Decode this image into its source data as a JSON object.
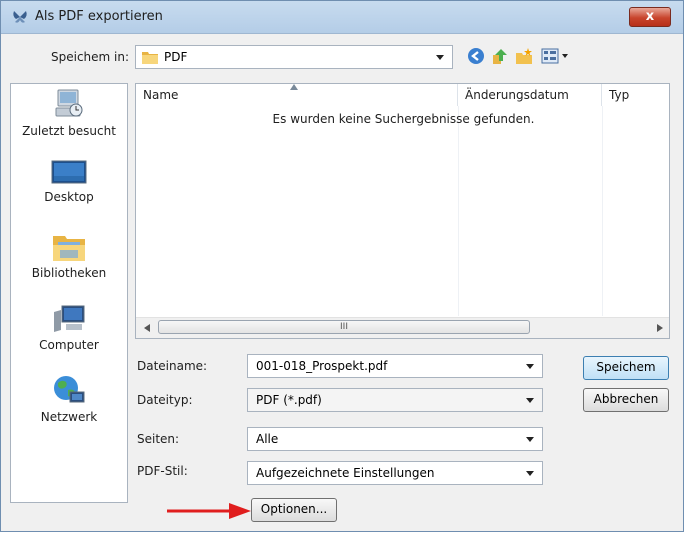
{
  "window": {
    "title": "Als PDF exportieren",
    "close_label": "x"
  },
  "location": {
    "label": "Speichem in:",
    "value": "PDF"
  },
  "sidebar": {
    "items": [
      {
        "label": "Zuletzt besucht",
        "icon": "recent-places-icon"
      },
      {
        "label": "Desktop",
        "icon": "desktop-icon"
      },
      {
        "label": "Bibliotheken",
        "icon": "libraries-icon"
      },
      {
        "label": "Computer",
        "icon": "computer-icon"
      },
      {
        "label": "Netzwerk",
        "icon": "network-icon"
      }
    ]
  },
  "filelist": {
    "columns": [
      "Name",
      "Änderungsdatum",
      "Typ"
    ],
    "empty_message": "Es wurden keine Suchergebnisse gefunden.",
    "scroll_grip": "III"
  },
  "form": {
    "filename": {
      "label": "Dateiname:",
      "value": "001-018_Prospekt.pdf"
    },
    "filetype": {
      "label": "Dateityp:",
      "value": "PDF (*.pdf)"
    },
    "pages": {
      "label": "Seiten:",
      "value": "Alle"
    },
    "pdfstyle": {
      "label": "PDF-Stil:",
      "value": "Aufgezeichnete Einstellungen"
    },
    "options_label": "Optionen..."
  },
  "buttons": {
    "save": "Speichem",
    "cancel": "Abbrechen"
  },
  "colors": {
    "annotation_arrow": "#e01e1e",
    "folder": "#f2c14e"
  }
}
